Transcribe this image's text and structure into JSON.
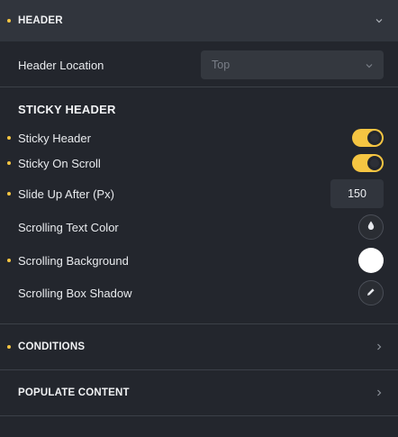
{
  "header_section": {
    "title": "HEADER",
    "header_location": {
      "label": "Header Location",
      "value": "Top"
    },
    "sticky_header_section": {
      "title": "STICKY HEADER",
      "rows": [
        {
          "label": "Sticky Header",
          "control": "toggle",
          "state": "on"
        },
        {
          "label": "Sticky On Scroll",
          "control": "toggle",
          "state": "on"
        },
        {
          "label": "Slide Up After (Px)",
          "control": "number",
          "value": "150"
        },
        {
          "label": "Scrolling Text Color",
          "control": "color-picker",
          "icon": "droplet-icon"
        },
        {
          "label": "Scrolling Background",
          "control": "color-swatch",
          "color": "#ffffff"
        },
        {
          "label": "Scrolling Box Shadow",
          "control": "edit-button",
          "icon": "pencil-icon"
        }
      ]
    }
  },
  "conditions_section": {
    "title": "CONDITIONS"
  },
  "populate_content_section": {
    "title": "POPULATE CONTENT"
  },
  "colors": {
    "accent": "#f5c542",
    "panel_bg": "#23262d",
    "header_bg": "#31353d"
  }
}
